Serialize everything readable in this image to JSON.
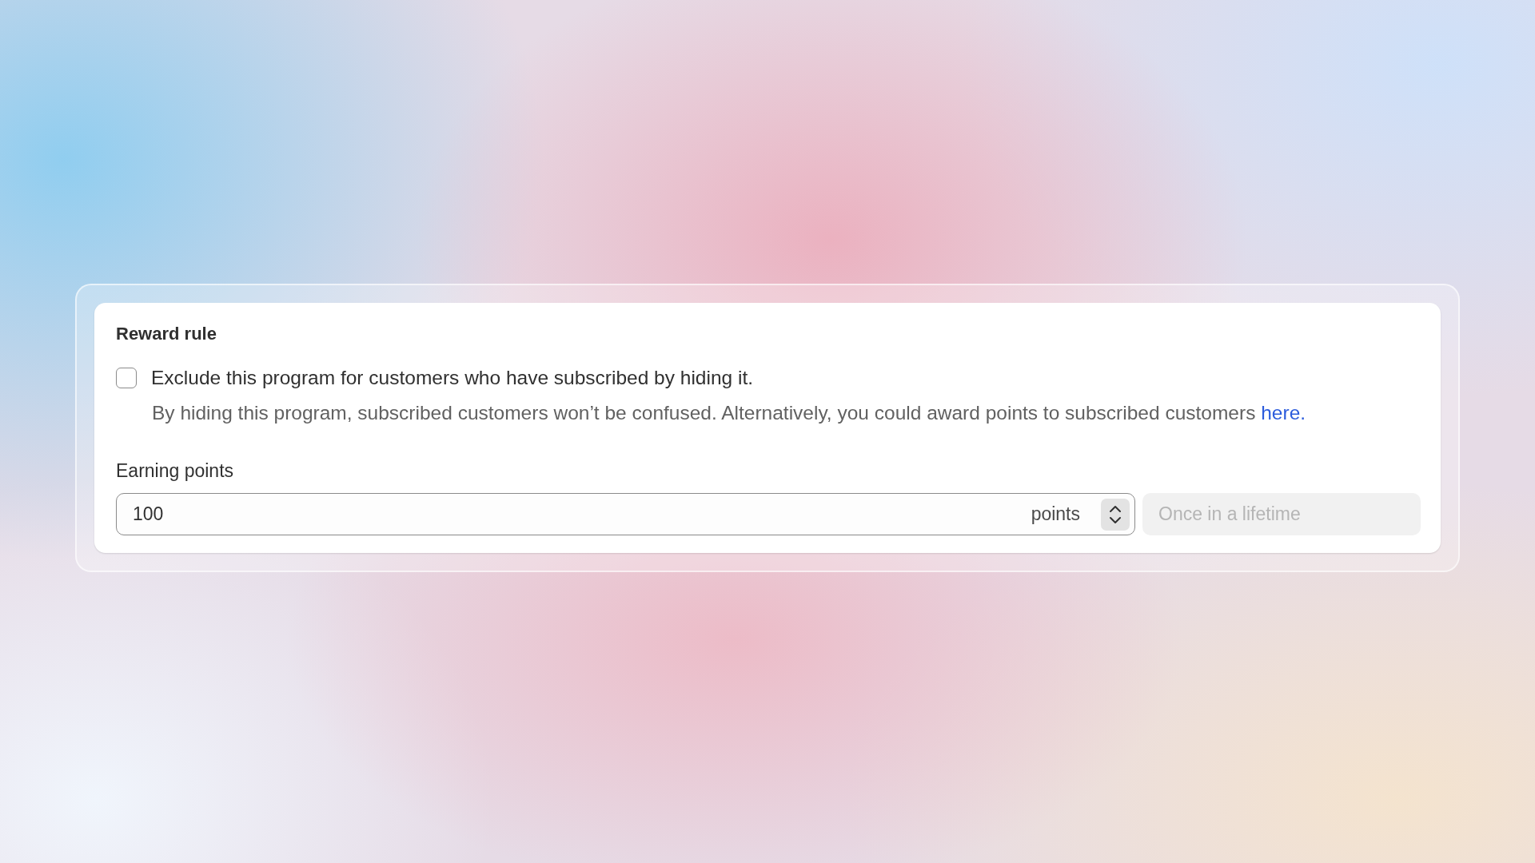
{
  "card": {
    "title": "Reward rule",
    "exclude_option": {
      "label": "Exclude this program for customers who have subscribed by hiding it.",
      "checked": false,
      "description": "By hiding this program, subscribed customers won’t be confused. Alternatively, you could award points to subscribed customers",
      "link": "here."
    },
    "earning_points": {
      "label": "Earning points",
      "value": "100",
      "suffix": "points"
    },
    "frequency": {
      "value": "Once in a lifetime",
      "disabled": true
    }
  }
}
